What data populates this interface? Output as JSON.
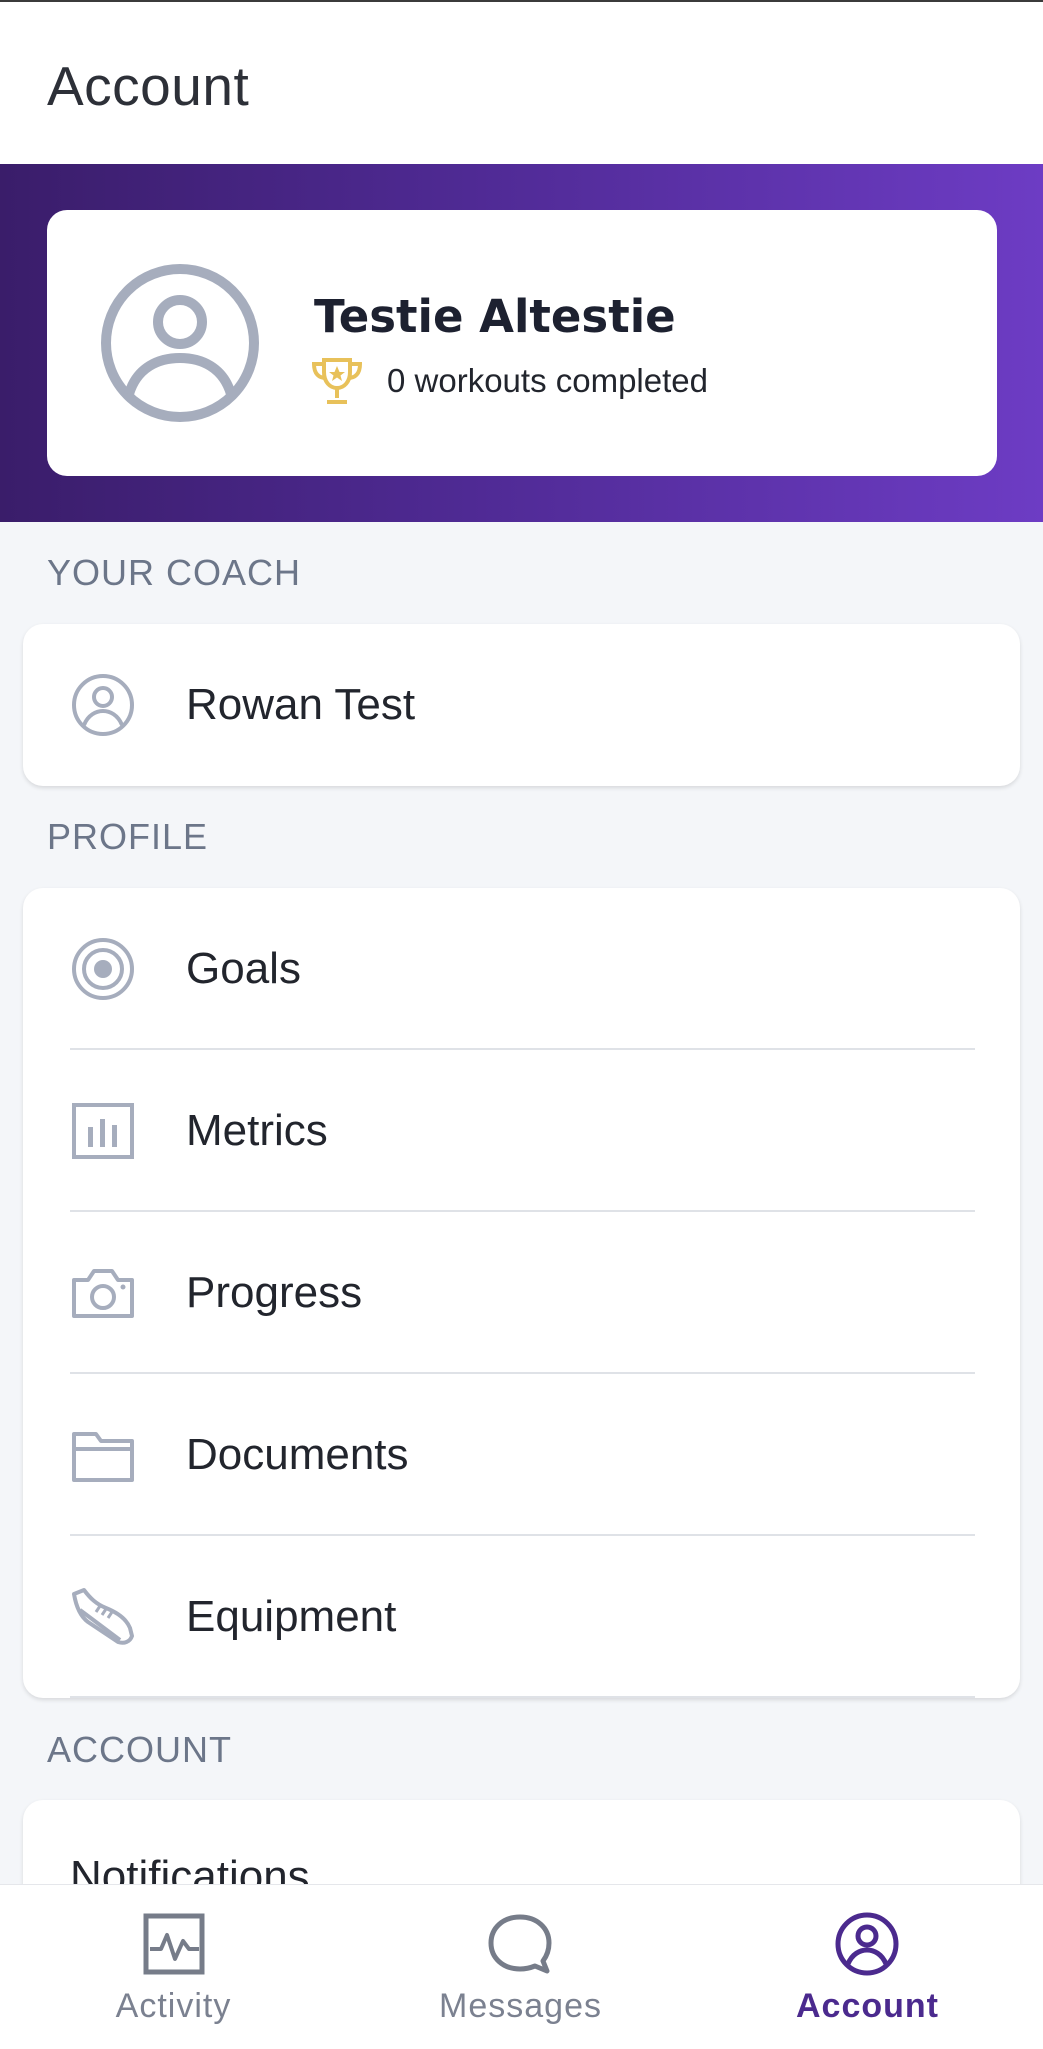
{
  "header": {
    "title": "Account"
  },
  "profile": {
    "name": "Testie Altestie",
    "workouts_text": "0 workouts completed",
    "avatar_icon": "user-circle-icon",
    "trophy_icon": "trophy-icon"
  },
  "coach_section": {
    "label": "YOUR COACH",
    "coach_name": "Rowan Test",
    "icon": "user-circle-icon"
  },
  "profile_section": {
    "label": "PROFILE",
    "items": [
      {
        "label": "Goals",
        "icon": "target-icon"
      },
      {
        "label": "Metrics",
        "icon": "bar-chart-icon"
      },
      {
        "label": "Progress",
        "icon": "camera-icon"
      },
      {
        "label": "Documents",
        "icon": "folder-icon"
      },
      {
        "label": "Equipment",
        "icon": "sneaker-icon"
      }
    ]
  },
  "account_section": {
    "label": "ACCOUNT",
    "items": [
      {
        "label": "Notifications"
      }
    ]
  },
  "bottom_nav": {
    "items": [
      {
        "label": "Activity",
        "icon": "activity-icon",
        "active": false
      },
      {
        "label": "Messages",
        "icon": "chat-bubble-icon",
        "active": false
      },
      {
        "label": "Account",
        "icon": "user-circle-icon",
        "active": true
      }
    ]
  },
  "colors": {
    "brand_purple": "#4b2a8e",
    "banner_start": "#3a1d6a",
    "banner_end": "#6d3cc4",
    "trophy_gold": "#e8c15a",
    "icon_gray": "#a6adbd",
    "section_label": "#6c7689"
  }
}
